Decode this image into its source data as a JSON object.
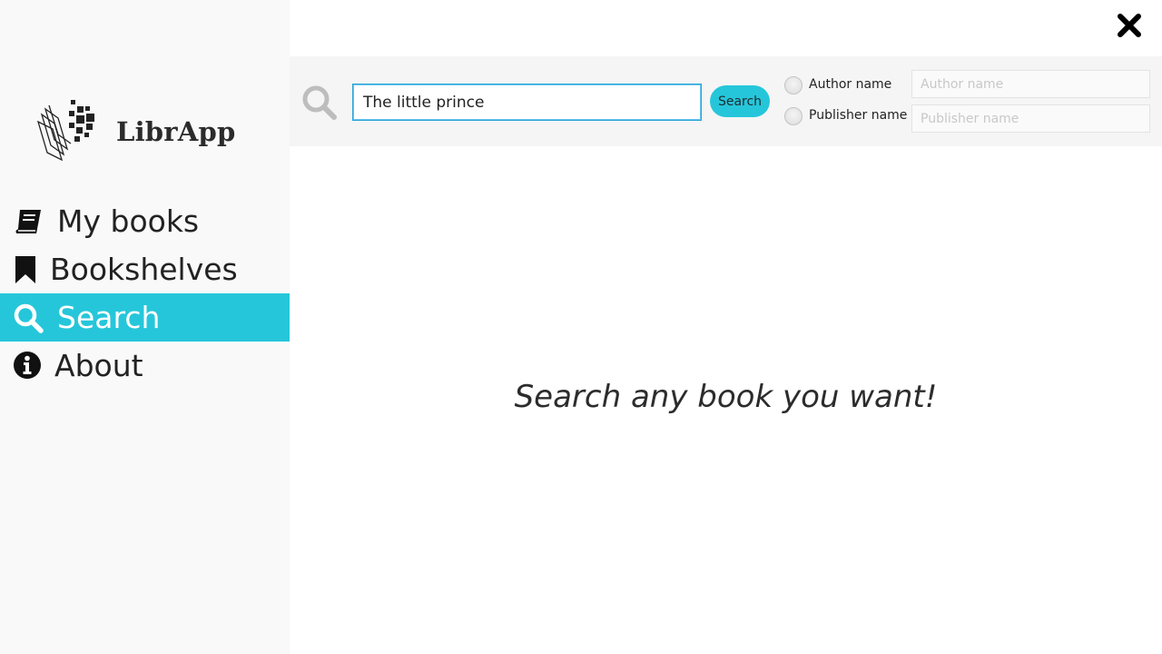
{
  "app": {
    "name": "LibrApp"
  },
  "colors": {
    "accent": "#26c6da",
    "sidebar_bg": "#f9f9f9",
    "search_bar_bg": "#f5f5f5",
    "input_border": "#26a3d6"
  },
  "sidebar": {
    "items": [
      {
        "label": "My books",
        "icon": "book-icon",
        "active": false
      },
      {
        "label": "Bookshelves",
        "icon": "bookmark-icon",
        "active": false
      },
      {
        "label": "Search",
        "icon": "search-icon",
        "active": true
      },
      {
        "label": "About",
        "icon": "info-icon",
        "active": false
      }
    ]
  },
  "search": {
    "query": "The little prince",
    "button_label": "Search",
    "filters": [
      {
        "label": "Author name",
        "placeholder": "Author name",
        "selected": false
      },
      {
        "label": "Publisher name",
        "placeholder": "Publisher name",
        "selected": false
      }
    ]
  },
  "main": {
    "message": "Search any book you want!"
  },
  "window": {
    "close_icon": "close-icon"
  }
}
